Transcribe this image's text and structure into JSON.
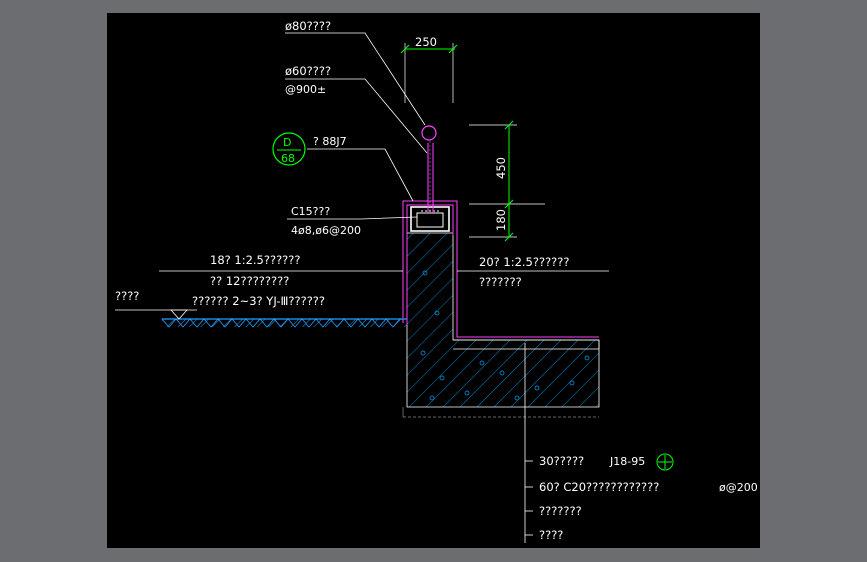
{
  "drawing": {
    "labels": {
      "rail_top": "ø80????",
      "rail_mid": "ø60????",
      "rail_spacing": "@900±",
      "ref_code": "? 88J7",
      "coping": "C15???",
      "rebar": "4ø8,ø6@200",
      "left_plaster": "18? 1:2.5??????",
      "left_layer2": "?? 12????????",
      "ground": "????",
      "left_layer3": "?????? 2~3? YJ-Ⅲ??????",
      "right_plaster": "20? 1:2.5??????",
      "right_layer2": "???????",
      "note1": "30?????",
      "note1_code": "J18-95",
      "note2": "60? C20????????????",
      "note2_spacing": "ø@200",
      "note3": "???????",
      "note4": "????"
    },
    "dimensions": {
      "width": "250",
      "height_upper": "450",
      "height_lower": "180"
    },
    "detail_bubble": {
      "top": "D",
      "bottom": "68"
    },
    "colors": {
      "background": "#000000",
      "frame": "#6b6d70",
      "leader": "#ffffff",
      "dimension": "#00ff00",
      "rail": "#ff00ff",
      "hatch": "#00b4ff",
      "ground": "#1fa0ff"
    }
  }
}
